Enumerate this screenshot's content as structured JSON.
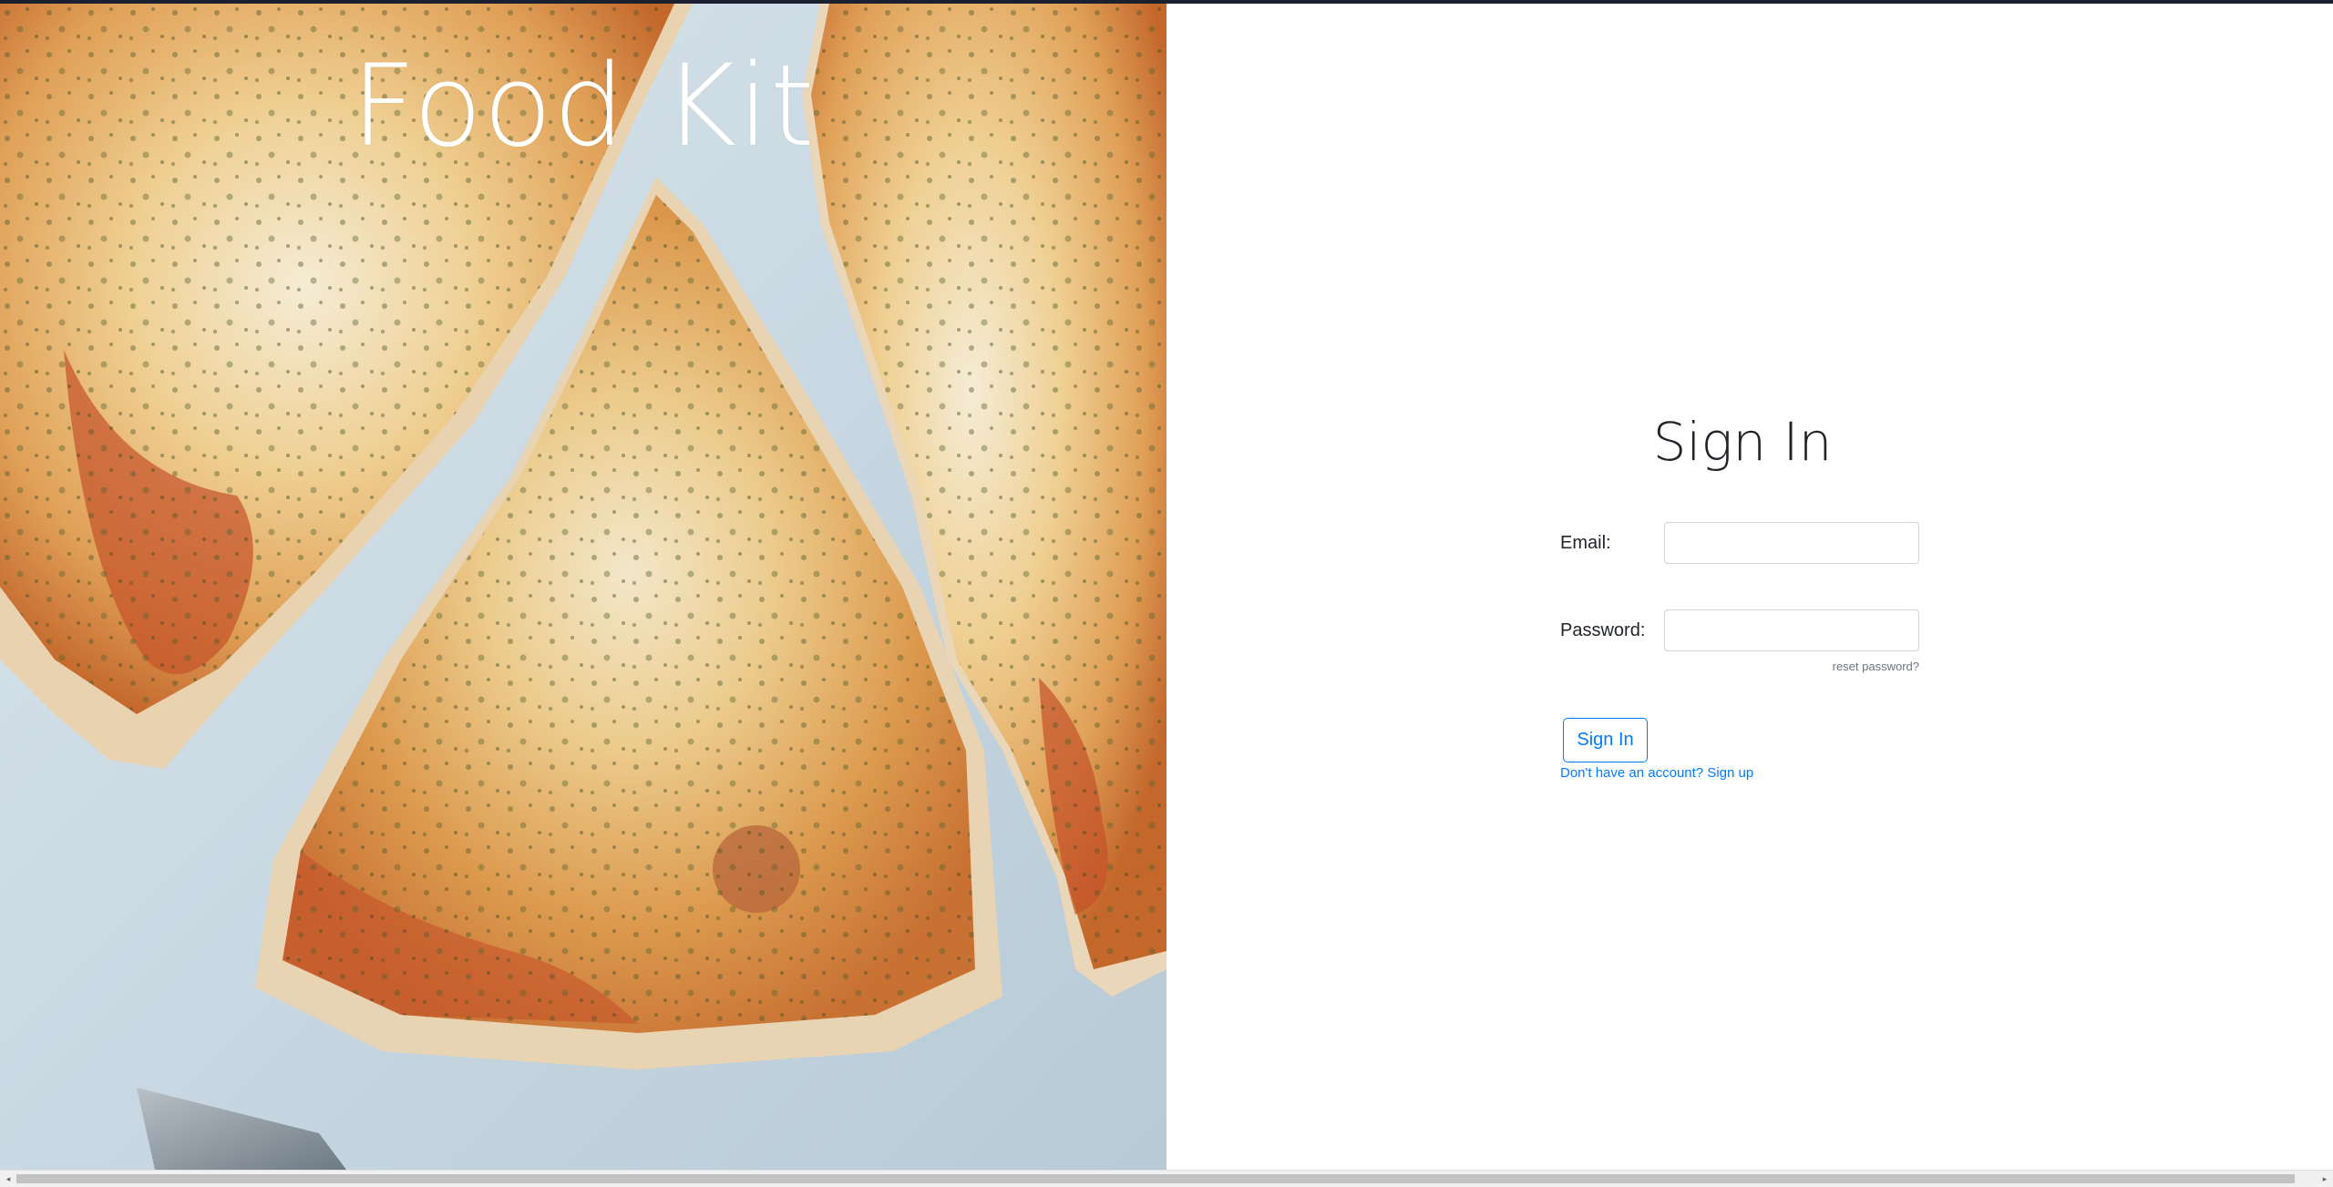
{
  "app": {
    "brand_title": "Food Kit"
  },
  "hero": {
    "image_subject": "pizza-photo"
  },
  "signin": {
    "heading": "Sign In",
    "email_label": "Email:",
    "email_value": "",
    "password_label": "Password:",
    "password_value": "",
    "reset_password_link": "reset password?",
    "submit_label": "Sign In",
    "signup_link": "Don't have an account? Sign up"
  },
  "colors": {
    "accent": "#007bff",
    "heading_text": "#212529",
    "muted_text": "#6c757d",
    "input_border": "#ced4da"
  },
  "scrollbar": {
    "left_arrow": "◂",
    "right_arrow": "▸"
  }
}
